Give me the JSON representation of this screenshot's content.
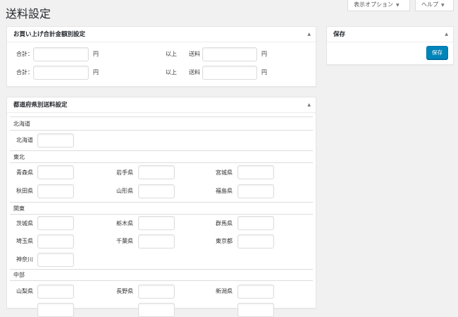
{
  "page": {
    "title": "送料設定"
  },
  "screen_meta": {
    "options_label": "表示オプション",
    "help_label": "ヘルプ",
    "arrow": "▼"
  },
  "amount_box": {
    "title": "お買い上げ合計金額別設定",
    "toggle": "▲",
    "rows": [
      {
        "total_label": "合計：",
        "yen1": "円",
        "above": "以上",
        "shipping": "送料",
        "yen2": "円"
      },
      {
        "total_label": "合計：",
        "yen1": "円",
        "above": "以上",
        "shipping": "送料",
        "yen2": "円"
      }
    ]
  },
  "save_box": {
    "title": "保存",
    "toggle": "▲",
    "button_label": "保存"
  },
  "pref_box": {
    "title": "都道府県別送料設定",
    "toggle": "▲",
    "regions": [
      {
        "name": "北海道",
        "prefectures": [
          "北海道"
        ]
      },
      {
        "name": "東北",
        "prefectures": [
          "青森県",
          "岩手県",
          "宮城県",
          "秋田県",
          "山形県",
          "福島県"
        ]
      },
      {
        "name": "関東",
        "prefectures": [
          "茨城県",
          "栃木県",
          "群馬県",
          "埼玉県",
          "千葉県",
          "東京都",
          "神奈川"
        ]
      },
      {
        "name": "中部",
        "prefectures": [
          "山梨県",
          "長野県",
          "新潟県"
        ]
      }
    ]
  }
}
